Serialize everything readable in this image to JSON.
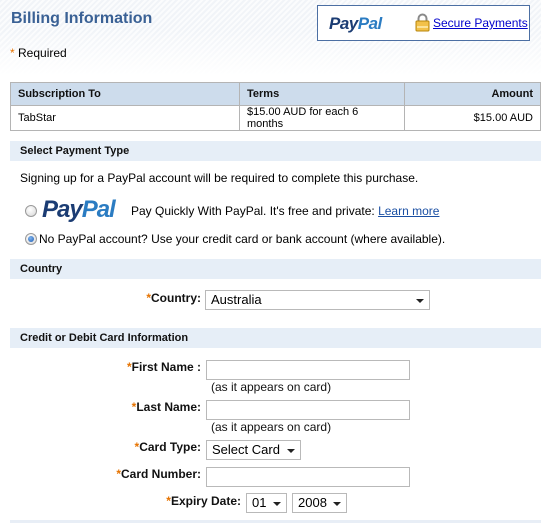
{
  "header": {
    "title": "Billing Information",
    "required_star": "*",
    "required_label": "Required",
    "paypal_logo": {
      "pay": "Pay",
      "pal": "Pal"
    },
    "secure_icon": "lock-icon",
    "secure_link": "Secure Payments"
  },
  "subscription_table": {
    "columns": [
      "Subscription To",
      "Terms",
      "Amount"
    ],
    "rows": [
      {
        "item": "TabStar",
        "terms": "$15.00 AUD for each 6 months",
        "amount": "$15.00 AUD"
      }
    ]
  },
  "payment_type": {
    "section_title": "Select Payment Type",
    "intro": "Signing up for a PayPal account will be required to complete this purchase.",
    "options": [
      {
        "logo_pay": "Pay",
        "logo_pal": "Pal",
        "label": "Pay Quickly With PayPal. It's free and private:",
        "link": "Learn more",
        "selected": false
      },
      {
        "label": "No PayPal account? Use your credit card or bank account (where available).",
        "selected": true
      }
    ]
  },
  "country": {
    "section_title": "Country",
    "label": "Country:",
    "value": "Australia"
  },
  "card": {
    "section_title": "Credit or Debit Card Information",
    "first_name": {
      "label": "First Name :",
      "value": "",
      "hint": "(as it appears on card)"
    },
    "last_name": {
      "label": "Last Name:",
      "value": "",
      "hint": "(as it appears on card)"
    },
    "card_type": {
      "label": "Card Type:",
      "value": "Select Card"
    },
    "card_number": {
      "label": "Card Number:",
      "value": ""
    },
    "expiry": {
      "label": "Expiry Date:",
      "month": "01",
      "year": "2008"
    }
  },
  "colors": {
    "title": "#3a6195",
    "required_star": "#e67300",
    "table_header": "#cddcec",
    "section_bar": "#e6eef7",
    "link": "#0000cc"
  }
}
